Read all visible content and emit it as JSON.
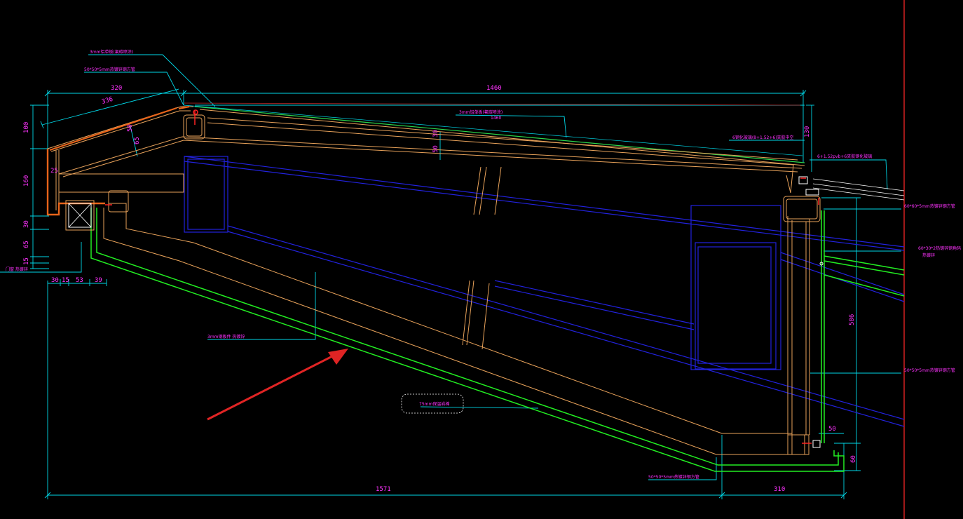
{
  "colors": {
    "background": "#000000",
    "dimension_line": "#00d8e8",
    "dimension_text": "#ff33ff",
    "frame_outline": "#e8a25a",
    "cladding_green": "#22ee22",
    "steel_blue": "#2222dd",
    "red": "#ff2222",
    "white": "#ffffff"
  },
  "dimensions": {
    "top_overall": "1460",
    "top_left": "320",
    "slope_left": "336",
    "left_100": "100",
    "left_160": "160",
    "left_30": "30",
    "left_65": "65",
    "left_15": "15",
    "bottom_30": "30",
    "bottom_15": "15",
    "bottom_53": "53",
    "bottom_39": "39",
    "inner_25": "25",
    "inner_65": "65",
    "inner_50": "50",
    "mid_50": "50",
    "mid_30": "30",
    "right_130": "130",
    "right_586": "586",
    "right_50_small": "50",
    "right_60": "60",
    "bottom_overall": "1571",
    "bottom_right": "310"
  },
  "annotations": {
    "top_plate_note": "3mm铝单板(氟碳喷涂)",
    "tube_note_left": "50*50*5mm热镀锌钢方管",
    "top_plate_note_mid": "3mm铝单板(氟碳喷涂)",
    "top_plate_sub": "1460",
    "glass_note": "6钢化玻璃(8+1.52+6)夹胶中空",
    "laminated_note": "6+1.52pvb+6夹胶钢化玻璃",
    "tube_note_right": "60*60*5mm热镀锌钢方管",
    "angle_note": "60*30*2热镀锌钢角码",
    "angle_note_2": "热镀锌",
    "tube_note_right2": "50*50*5mm热镀锌钢方管",
    "steel_note": "3mm钢板件 热镀锌",
    "insulation_note": "75mm保温岩棉",
    "tube_note_bottom": "50*50*5mm热镀锌钢方管",
    "left_bottom_note": "门窗 热镀锌"
  }
}
